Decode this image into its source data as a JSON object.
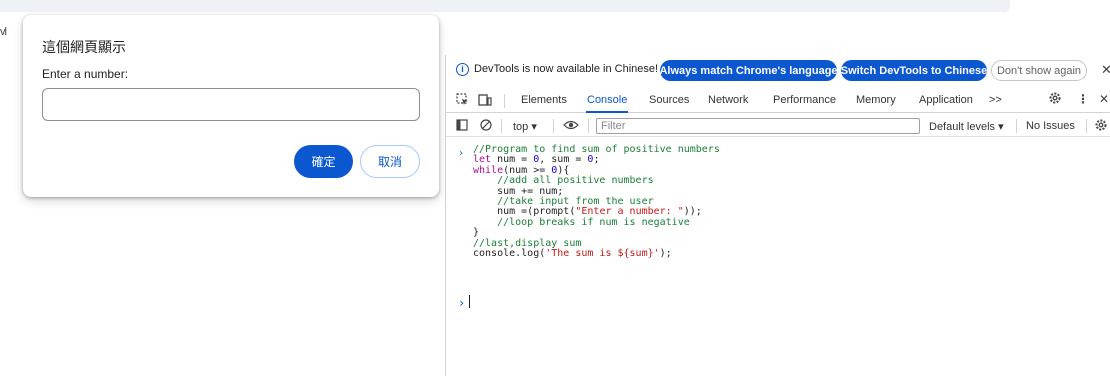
{
  "page": {
    "edge_text": "vl"
  },
  "dialog": {
    "title": "這個網頁顯示",
    "label": "Enter a number:",
    "input_value": "",
    "ok_label": "確定",
    "cancel_label": "取消"
  },
  "infobar": {
    "message": "DevTools is now available in Chinese!",
    "match_label": "Always match Chrome's language",
    "switch_label": "Switch DevTools to Chinese",
    "dont_show_label": "Don't show again"
  },
  "tabs": {
    "elements": "Elements",
    "console": "Console",
    "sources": "Sources",
    "network": "Network",
    "performance": "Performance",
    "memory": "Memory",
    "application": "Application",
    "more": ">>"
  },
  "toolbar": {
    "context": "top ▾",
    "filter_placeholder": "Filter",
    "levels": "Default levels ▾",
    "issues": "No Issues"
  },
  "console": {
    "lines": [
      [
        {
          "t": "//Program to find sum of positive numbers",
          "c": "cmt"
        }
      ],
      [
        {
          "t": "let",
          "c": "kw"
        },
        {
          "t": " num = ",
          "c": "plain"
        },
        {
          "t": "0",
          "c": "num"
        },
        {
          "t": ", sum = ",
          "c": "plain"
        },
        {
          "t": "0",
          "c": "num"
        },
        {
          "t": ";",
          "c": "plain"
        }
      ],
      [
        {
          "t": "while",
          "c": "kw"
        },
        {
          "t": "(num >= ",
          "c": "plain"
        },
        {
          "t": "0",
          "c": "num"
        },
        {
          "t": "){",
          "c": "plain"
        }
      ],
      [
        {
          "t": "    //add all positive numbers",
          "c": "cmt"
        }
      ],
      [
        {
          "t": "    sum += num;",
          "c": "plain"
        }
      ],
      [
        {
          "t": "    //take input from the user",
          "c": "cmt"
        }
      ],
      [
        {
          "t": "    num =(prompt(",
          "c": "plain"
        },
        {
          "t": "\"Enter a number: \"",
          "c": "str"
        },
        {
          "t": "));",
          "c": "plain"
        }
      ],
      [
        {
          "t": "    //loop breaks if num is negative",
          "c": "cmt"
        }
      ],
      [
        {
          "t": "}",
          "c": "plain"
        }
      ],
      [
        {
          "t": "//last,display sum",
          "c": "cmt"
        }
      ],
      [
        {
          "t": "console.log(",
          "c": "plain"
        },
        {
          "t": "'The sum is ${sum}'",
          "c": "str"
        },
        {
          "t": ");",
          "c": "plain"
        }
      ]
    ]
  },
  "colors": {
    "accent": "#0b57d0",
    "comment": "#1a7f37",
    "keyword": "#aa0d91",
    "number": "#1c00cf",
    "string": "#c41a16"
  },
  "icons": [
    "info-icon",
    "inspect-icon",
    "device-toolbar-icon",
    "settings-icon",
    "more-vert-icon",
    "close-icon",
    "sidebar-icon",
    "clear-console-icon",
    "eye-icon",
    "prompt-caret-icon"
  ]
}
